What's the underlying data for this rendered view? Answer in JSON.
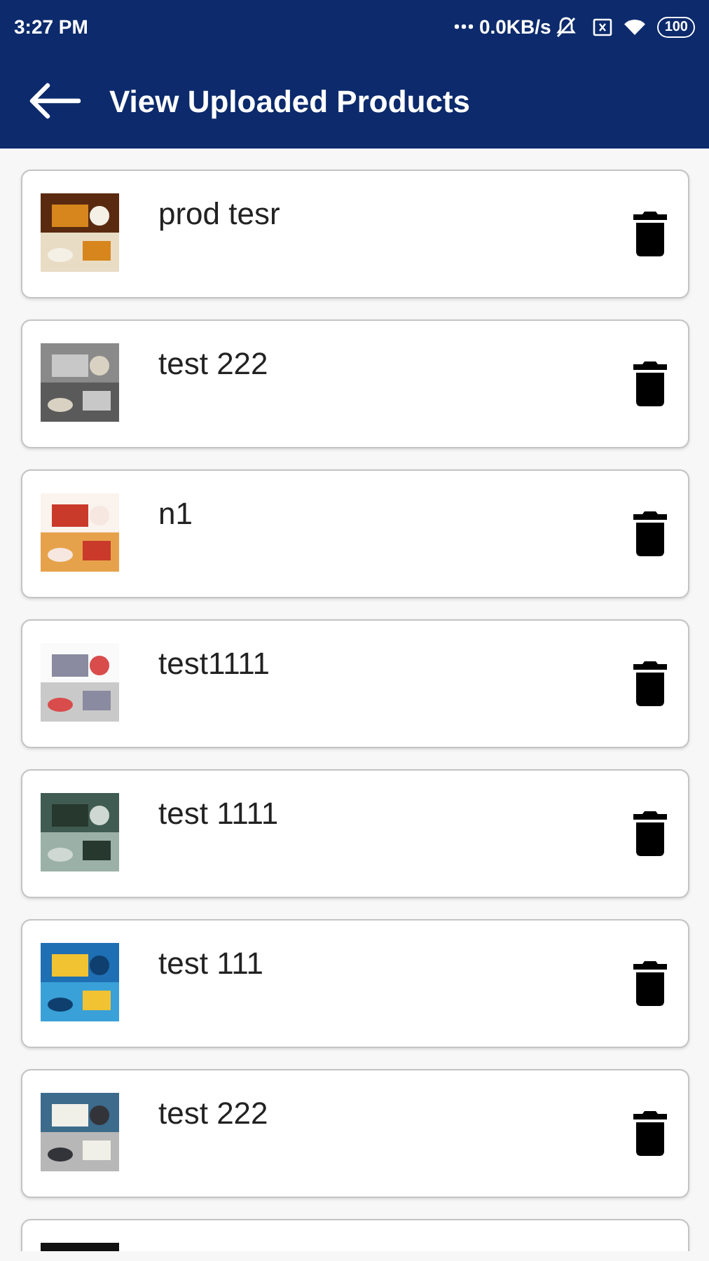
{
  "status_bar": {
    "time": "3:27 PM",
    "speed": "0.0KB/s",
    "battery": "100"
  },
  "app_bar": {
    "title": "View Uploaded Products"
  },
  "products": [
    {
      "name": "prod tesr"
    },
    {
      "name": "test 222"
    },
    {
      "name": "n1"
    },
    {
      "name": "test1111"
    },
    {
      "name": "test 1111"
    },
    {
      "name": "test 111"
    },
    {
      "name": "test 222"
    },
    {
      "kind": "picture"
    }
  ]
}
